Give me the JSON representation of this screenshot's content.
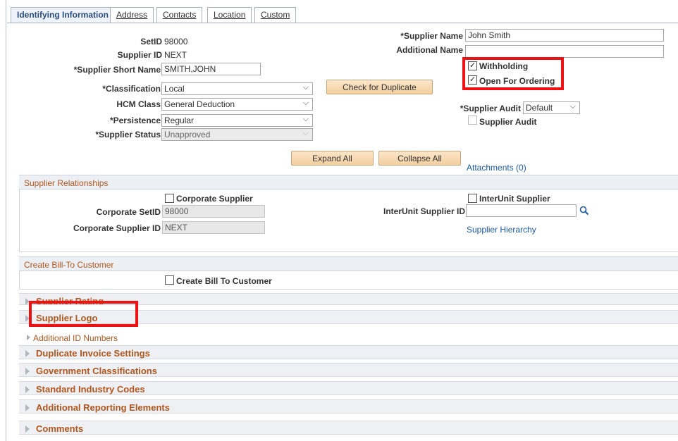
{
  "tabs": [
    {
      "label": "Identifying Information",
      "active": true
    },
    {
      "label": "Address"
    },
    {
      "label": "Contacts"
    },
    {
      "label": "Location"
    },
    {
      "label": "Custom"
    }
  ],
  "left": {
    "setid_label": "SetID",
    "setid_value": "98000",
    "supplier_id_label": "Supplier ID",
    "supplier_id_value": "NEXT",
    "short_name_label": "*Supplier Short Name",
    "short_name_value": "SMITH,JOHN",
    "classification_label": "*Classification",
    "classification_value": "Local",
    "hcm_class_label": "HCM Class",
    "hcm_class_value": "General Deduction",
    "persistence_label": "*Persistence",
    "persistence_value": "Regular",
    "status_label": "*Supplier Status",
    "status_value": "Unapproved"
  },
  "right": {
    "supplier_name_label": "*Supplier Name",
    "supplier_name_value": "John Smith",
    "additional_name_label": "Additional Name",
    "additional_name_value": "",
    "withholding_label": "Withholding",
    "withholding_checked": true,
    "open_for_ordering_label": "Open For Ordering",
    "open_for_ordering_checked": true,
    "audit_label": "*Supplier Audit",
    "audit_value": "Default",
    "audit_checkbox_label": "Supplier Audit"
  },
  "buttons": {
    "check_duplicate": "Check for Duplicate",
    "expand_all": "Expand All",
    "collapse_all": "Collapse All"
  },
  "attachments_link": "Attachments (0)",
  "relationships": {
    "title": "Supplier Relationships",
    "corporate_supplier_label": "Corporate Supplier",
    "corporate_setid_label": "Corporate SetID",
    "corporate_setid_value": "98000",
    "corporate_supplier_id_label": "Corporate Supplier ID",
    "corporate_supplier_id_value": "NEXT",
    "interunit_supplier_label": "InterUnit Supplier",
    "interunit_supplier_id_label": "InterUnit Supplier ID",
    "interunit_supplier_id_value": "",
    "hierarchy_link": "Supplier Hierarchy"
  },
  "bill_to": {
    "title": "Create Bill-To Customer",
    "checkbox_label": "Create Bill To Customer"
  },
  "collapsibles": {
    "supplier_rating": "Supplier Rating",
    "supplier_logo": "Supplier Logo",
    "additional_id_numbers": "Additional ID Numbers",
    "duplicate_invoice": "Duplicate Invoice Settings",
    "government_classifications": "Government Classifications",
    "standard_industry_codes": "Standard Industry Codes",
    "additional_reporting": "Additional Reporting Elements",
    "comments": "Comments"
  },
  "colors": {
    "highlight": "#ee1111",
    "section_text": "#b3561d",
    "button": "#f3cf9f",
    "link": "#1b5aa8"
  }
}
